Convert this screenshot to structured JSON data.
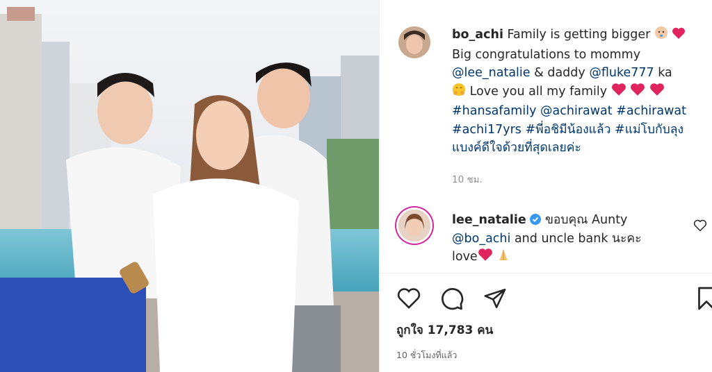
{
  "post": {
    "author": "bo_achi",
    "caption_line1": "Family is getting bigger",
    "caption_line2": "Big congratulations to mommy",
    "mention1": "@lee_natalie",
    "caption_and_daddy": "& daddy",
    "mention2": "@fluke777",
    "caption_ka": "ka",
    "caption_love": "Love you all my family",
    "tag1": "#hansafamily",
    "mention3": "@achirawat",
    "tag2": "#achirawat",
    "tag3": "#achi17yrs",
    "tag4": "#พี่อชิมีน้องแล้ว",
    "tag5": "#แม่โบกับลุง",
    "tag5b": "แบงค์ดีใจด้วยที่สุดเลยค่ะ",
    "time": "10 ชม."
  },
  "reply": {
    "author": "lee_natalie",
    "text1": "ขอบคุณ Aunty",
    "mention": "@bo_achi",
    "text2": "and uncle bank นะคะ",
    "text3": "love"
  },
  "footer": {
    "likes": "ถูกใจ 17,783 คน",
    "posted": "10 ชั่วโมงที่แล้ว"
  },
  "icons": [
    "heart-icon",
    "comment-icon",
    "share-icon",
    "bookmark-icon",
    "verified-badge-icon"
  ],
  "colors": {
    "mention": "#00376b",
    "verified": "#3897f0",
    "heart": "#e0245e"
  }
}
